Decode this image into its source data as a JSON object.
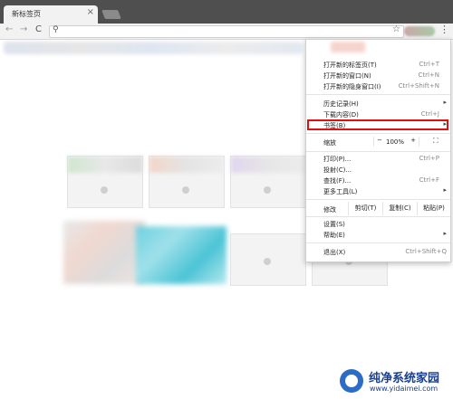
{
  "tab": {
    "title": "新标签页",
    "close": "×"
  },
  "toolbar": {
    "back": "←",
    "forward": "→",
    "reload": "C",
    "search_icon": "⚲",
    "star": "☆",
    "menu": "⋮"
  },
  "menu": {
    "items": [
      {
        "label": "打开新的标签页(T)",
        "shortcut": "Ctrl+T"
      },
      {
        "label": "打开新的窗口(N)",
        "shortcut": "Ctrl+N"
      },
      {
        "label": "打开新的隐身窗口(I)",
        "shortcut": "Ctrl+Shift+N"
      },
      {
        "label": "历史记录(H)",
        "shortcut": ""
      },
      {
        "label": "下载内容(D)",
        "shortcut": "Ctrl+J"
      },
      {
        "label": "书签(B)",
        "shortcut": ""
      },
      {
        "label": "打印(P)...",
        "shortcut": "Ctrl+P"
      },
      {
        "label": "投射(C)...",
        "shortcut": ""
      },
      {
        "label": "查找(F)...",
        "shortcut": "Ctrl+F"
      },
      {
        "label": "更多工具(L)",
        "shortcut": ""
      },
      {
        "label": "设置(S)",
        "shortcut": ""
      },
      {
        "label": "帮助(E)",
        "shortcut": ""
      },
      {
        "label": "退出(X)",
        "shortcut": "Ctrl+Shift+Q"
      }
    ],
    "zoom": {
      "label": "缩放",
      "minus": "−",
      "value": "100%",
      "plus": "+",
      "fullscreen": "⛶"
    },
    "edit": {
      "label": "修改",
      "cut": "剪切(T)",
      "copy": "复制(C)",
      "paste": "粘贴(P)"
    }
  },
  "watermark": {
    "name": "纯净系统家园",
    "url": "www.yidaimei.com"
  }
}
